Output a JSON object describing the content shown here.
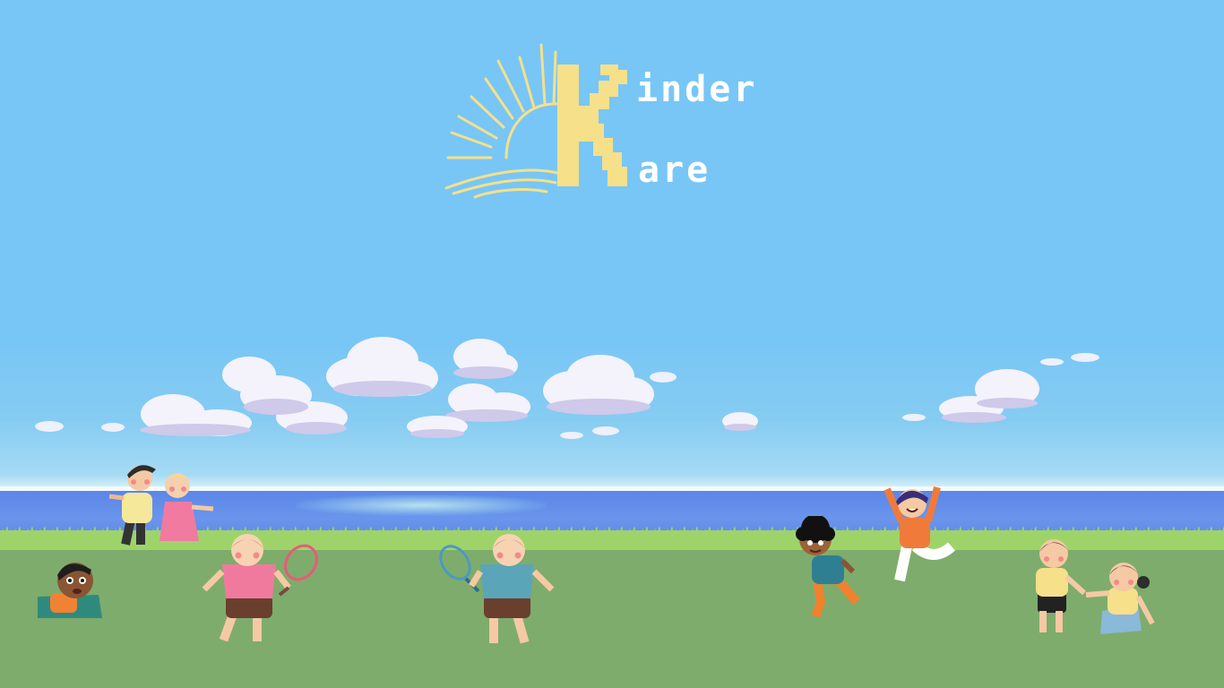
{
  "logo": {
    "line1": "inder",
    "line2": "are"
  },
  "colors": {
    "sky": "#78c6f6",
    "sea": "#5b86e8",
    "grass": "#9ed36a",
    "field": "#7eac6c",
    "logo_yellow": "#f6e08a"
  },
  "icons": [
    "sun-icon",
    "letter-k-icon",
    "cloud-icon",
    "child-illustration"
  ]
}
